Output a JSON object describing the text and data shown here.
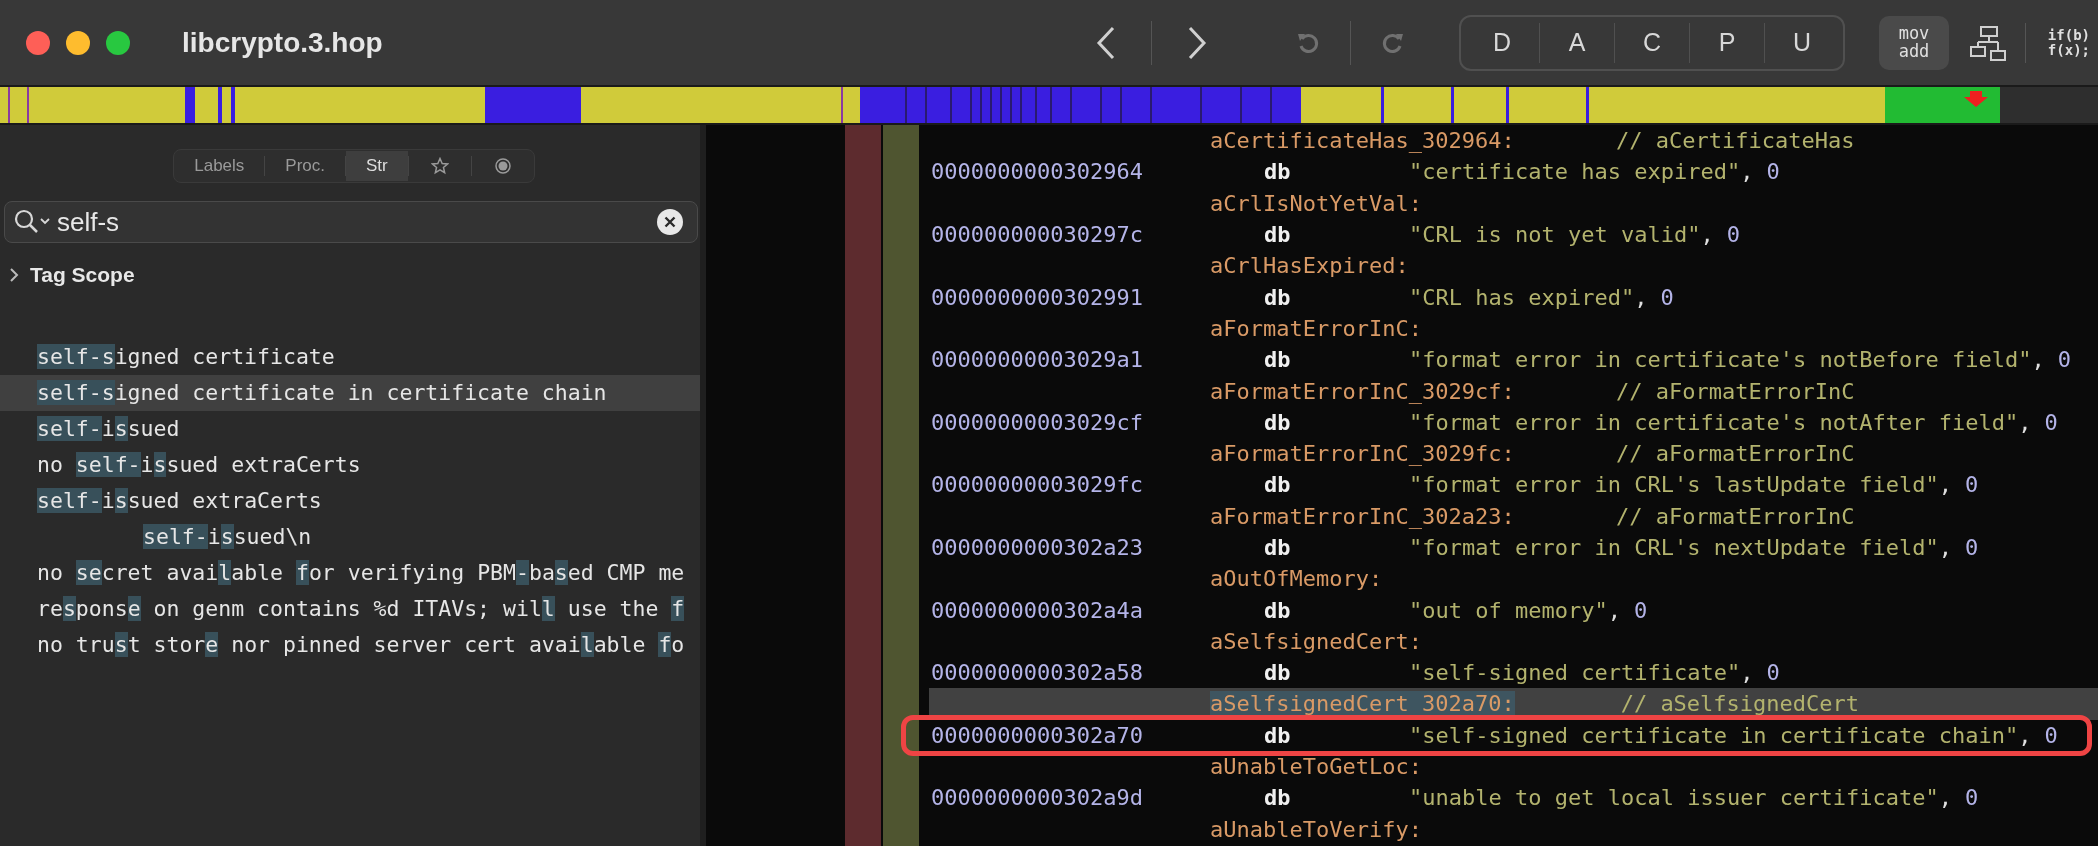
{
  "window": {
    "title": "libcrypto.3.hop"
  },
  "toolbar": {
    "modes": [
      {
        "label": "D"
      },
      {
        "label": "A"
      },
      {
        "label": "C"
      },
      {
        "label": "P"
      },
      {
        "label": "U"
      }
    ],
    "asm_button": {
      "lines": [
        "mov",
        "add"
      ]
    },
    "pseudo_button": {
      "lines": [
        "if(b)",
        "f(x);"
      ]
    }
  },
  "sidebar": {
    "tabs": [
      {
        "kind": "text",
        "label": "Labels",
        "selected": false
      },
      {
        "kind": "text",
        "label": "Proc.",
        "selected": false
      },
      {
        "kind": "text",
        "label": "Str",
        "selected": true
      },
      {
        "kind": "star",
        "selected": false
      },
      {
        "kind": "dot",
        "selected": false
      }
    ],
    "search": {
      "value": "self-s"
    },
    "tag_scope": {
      "label": "Tag Scope",
      "expanded": false
    },
    "results": [
      {
        "selected": false,
        "segments": [
          {
            "text": "self-s",
            "match": true
          },
          {
            "text": "igned certificate",
            "match": false
          }
        ]
      },
      {
        "selected": true,
        "segments": [
          {
            "text": "self-s",
            "match": true
          },
          {
            "text": "igned certificate in certificate chain",
            "match": false
          }
        ]
      },
      {
        "selected": false,
        "segments": [
          {
            "text": "self-",
            "match": true
          },
          {
            "text": "i",
            "match": false
          },
          {
            "text": "s",
            "match": true
          },
          {
            "text": "sued",
            "match": false
          }
        ]
      },
      {
        "selected": false,
        "segments": [
          {
            "text": "no ",
            "match": false
          },
          {
            "text": "self-",
            "match": true
          },
          {
            "text": "i",
            "match": false
          },
          {
            "text": "s",
            "match": true
          },
          {
            "text": "sued extraCerts",
            "match": false
          }
        ]
      },
      {
        "selected": false,
        "segments": [
          {
            "text": "self-",
            "match": true
          },
          {
            "text": "i",
            "match": false
          },
          {
            "text": "s",
            "match": true
          },
          {
            "text": "sued extraCerts",
            "match": false
          }
        ]
      },
      {
        "selected": false,
        "indented": true,
        "segments": [
          {
            "text": "self-",
            "match": true
          },
          {
            "text": "i",
            "match": false
          },
          {
            "text": "s",
            "match": true
          },
          {
            "text": "sued\\n",
            "match": false
          }
        ]
      },
      {
        "selected": false,
        "segments": [
          {
            "text": "no ",
            "match": false
          },
          {
            "text": "se",
            "match": true
          },
          {
            "text": "cret avai",
            "match": false
          },
          {
            "text": "l",
            "match": true
          },
          {
            "text": "able ",
            "match": false
          },
          {
            "text": "f",
            "match": true
          },
          {
            "text": "or verifying PBM",
            "match": false
          },
          {
            "text": "-",
            "match": true
          },
          {
            "text": "ba",
            "match": false
          },
          {
            "text": "s",
            "match": true
          },
          {
            "text": "ed CMP me",
            "match": false
          }
        ]
      },
      {
        "selected": false,
        "segments": [
          {
            "text": "re",
            "match": false
          },
          {
            "text": "s",
            "match": true
          },
          {
            "text": "pons",
            "match": false
          },
          {
            "text": "e",
            "match": true
          },
          {
            "text": " on genm contains %d ITAVs; wil",
            "match": false
          },
          {
            "text": "l",
            "match": true
          },
          {
            "text": " use the ",
            "match": false
          },
          {
            "text": "f",
            "match": true
          }
        ]
      },
      {
        "selected": false,
        "segments": [
          {
            "text": "no tru",
            "match": false
          },
          {
            "text": "s",
            "match": true
          },
          {
            "text": "t stor",
            "match": false
          },
          {
            "text": "e",
            "match": true
          },
          {
            "text": " nor pinned server cert avai",
            "match": false
          },
          {
            "text": "l",
            "match": true
          },
          {
            "text": "able ",
            "match": false
          },
          {
            "text": "f",
            "match": true
          },
          {
            "text": "o",
            "match": false
          }
        ]
      }
    ]
  },
  "listing": [
    {
      "kind": "label",
      "name": "aCertificateHas_302964:",
      "comment": "// aCertificateHas",
      "selected": false
    },
    {
      "kind": "data",
      "address": "0000000000302964",
      "mnemonic": "db",
      "string": "\"certificate has expired\"",
      "separator": ",",
      "value": "0",
      "annotated": false
    },
    {
      "kind": "label",
      "name": "aCrlIsNotYetVal:",
      "selected": false
    },
    {
      "kind": "data",
      "address": "000000000030297c",
      "mnemonic": "db",
      "string": "\"CRL is not yet valid\"",
      "separator": ",",
      "value": "0",
      "annotated": false
    },
    {
      "kind": "label",
      "name": "aCrlHasExpired:",
      "selected": false
    },
    {
      "kind": "data",
      "address": "0000000000302991",
      "mnemonic": "db",
      "string": "\"CRL has expired\"",
      "separator": ",",
      "value": "0",
      "annotated": false
    },
    {
      "kind": "label",
      "name": "aFormatErrorInC:",
      "selected": false
    },
    {
      "kind": "data",
      "address": "00000000003029a1",
      "mnemonic": "db",
      "string": "\"format error in certificate's notBefore field\"",
      "separator": ",",
      "value": "0",
      "annotated": false
    },
    {
      "kind": "label",
      "name": "aFormatErrorInC_3029cf:",
      "comment": "// aFormatErrorInC",
      "selected": false
    },
    {
      "kind": "data",
      "address": "00000000003029cf",
      "mnemonic": "db",
      "string": "\"format error in certificate's notAfter field\"",
      "separator": ",",
      "value": "0",
      "annotated": false
    },
    {
      "kind": "label",
      "name": "aFormatErrorInC_3029fc:",
      "comment": "// aFormatErrorInC",
      "selected": false
    },
    {
      "kind": "data",
      "address": "00000000003029fc",
      "mnemonic": "db",
      "string": "\"format error in CRL's lastUpdate field\"",
      "separator": ",",
      "value": "0",
      "annotated": false
    },
    {
      "kind": "label",
      "name": "aFormatErrorInC_302a23:",
      "comment": "// aFormatErrorInC",
      "selected": false
    },
    {
      "kind": "data",
      "address": "0000000000302a23",
      "mnemonic": "db",
      "string": "\"format error in CRL's nextUpdate field\"",
      "separator": ",",
      "value": "0",
      "annotated": false
    },
    {
      "kind": "label",
      "name": "aOutOfMemory:",
      "selected": false
    },
    {
      "kind": "data",
      "address": "0000000000302a4a",
      "mnemonic": "db",
      "string": "\"out of memory\"",
      "separator": ",",
      "value": "0",
      "annotated": false
    },
    {
      "kind": "label",
      "name": "aSelfsignedCert:",
      "selected": false
    },
    {
      "kind": "data",
      "address": "0000000000302a58",
      "mnemonic": "db",
      "string": "\"self-signed certificate\"",
      "separator": ",",
      "value": "0",
      "annotated": false
    },
    {
      "kind": "label",
      "name": "aSelfsignedCert_302a70:",
      "comment": "// aSelfsignedCert",
      "selected": true
    },
    {
      "kind": "data",
      "address": "0000000000302a70",
      "mnemonic": "db",
      "string": "\"self-signed certificate in certificate chain\"",
      "separator": ",",
      "value": "0",
      "annotated": true
    },
    {
      "kind": "label",
      "name": "aUnableToGetLoc:",
      "selected": false
    },
    {
      "kind": "data",
      "address": "0000000000302a9d",
      "mnemonic": "db",
      "string": "\"unable to get local issuer certificate\"",
      "separator": ",",
      "value": "0",
      "annotated": false
    },
    {
      "kind": "label",
      "name": "aUnableToVerify:",
      "selected": false
    }
  ]
}
